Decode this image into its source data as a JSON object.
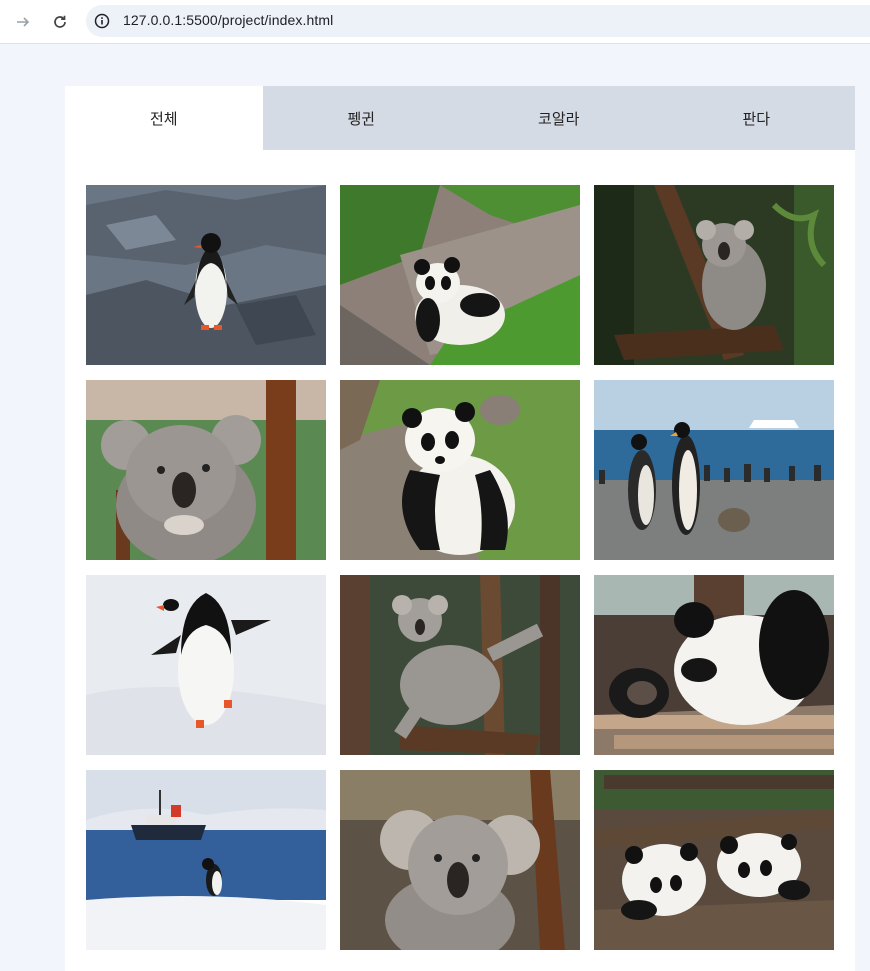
{
  "browser": {
    "url": "127.0.0.1:5500/project/index.html"
  },
  "tabs": [
    {
      "label": "전체",
      "active": true
    },
    {
      "label": "펭귄",
      "active": false
    },
    {
      "label": "코알라",
      "active": false
    },
    {
      "label": "판다",
      "active": false
    }
  ],
  "gallery": {
    "photos": [
      {
        "subject": "penguin"
      },
      {
        "subject": "panda"
      },
      {
        "subject": "koala"
      },
      {
        "subject": "koala"
      },
      {
        "subject": "panda"
      },
      {
        "subject": "penguin"
      },
      {
        "subject": "penguin"
      },
      {
        "subject": "koala"
      },
      {
        "subject": "panda"
      },
      {
        "subject": "penguin"
      },
      {
        "subject": "koala"
      },
      {
        "subject": "panda"
      }
    ]
  }
}
